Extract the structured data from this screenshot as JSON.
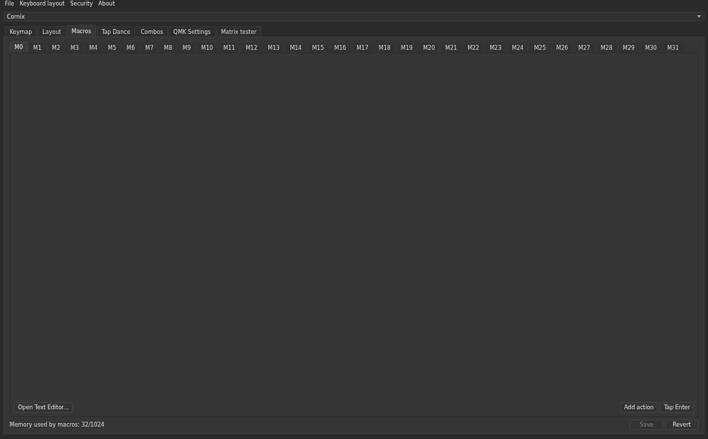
{
  "menu_bar": [
    "File",
    "Keyboard layout",
    "Security",
    "About"
  ],
  "device_selector": {
    "value": "Cornix"
  },
  "tabs": [
    {
      "label": "Keymap",
      "selected": false
    },
    {
      "label": "Layout",
      "selected": false
    },
    {
      "label": "Macros",
      "selected": true
    },
    {
      "label": "Tap Dance",
      "selected": false
    },
    {
      "label": "Combos",
      "selected": false
    },
    {
      "label": "QMK Settings",
      "selected": false
    },
    {
      "label": "Matrix tester",
      "selected": false
    }
  ],
  "macro_tabs": [
    {
      "label": "M0",
      "selected": true
    },
    {
      "label": "M1",
      "selected": false
    },
    {
      "label": "M2",
      "selected": false
    },
    {
      "label": "M3",
      "selected": false
    },
    {
      "label": "M4",
      "selected": false
    },
    {
      "label": "M5",
      "selected": false
    },
    {
      "label": "M6",
      "selected": false
    },
    {
      "label": "M7",
      "selected": false
    },
    {
      "label": "M8",
      "selected": false
    },
    {
      "label": "M9",
      "selected": false
    },
    {
      "label": "M10",
      "selected": false
    },
    {
      "label": "M11",
      "selected": false
    },
    {
      "label": "M12",
      "selected": false
    },
    {
      "label": "M13",
      "selected": false
    },
    {
      "label": "M14",
      "selected": false
    },
    {
      "label": "M15",
      "selected": false
    },
    {
      "label": "M16",
      "selected": false
    },
    {
      "label": "M17",
      "selected": false
    },
    {
      "label": "M18",
      "selected": false
    },
    {
      "label": "M19",
      "selected": false
    },
    {
      "label": "M20",
      "selected": false
    },
    {
      "label": "M21",
      "selected": false
    },
    {
      "label": "M22",
      "selected": false
    },
    {
      "label": "M23",
      "selected": false
    },
    {
      "label": "M24",
      "selected": false
    },
    {
      "label": "M25",
      "selected": false
    },
    {
      "label": "M26",
      "selected": false
    },
    {
      "label": "M27",
      "selected": false
    },
    {
      "label": "M28",
      "selected": false
    },
    {
      "label": "M29",
      "selected": false
    },
    {
      "label": "M30",
      "selected": false
    },
    {
      "label": "M31",
      "selected": false
    }
  ],
  "editor_buttons_left": [
    "Open Text Editor..."
  ],
  "editor_buttons_right": [
    "Add action",
    "Tap Enter"
  ],
  "memory_status": "Memory used by macros: 32/1024",
  "footer_buttons": [
    {
      "label": "Save",
      "disabled": true
    },
    {
      "label": "Revert",
      "disabled": false
    }
  ]
}
